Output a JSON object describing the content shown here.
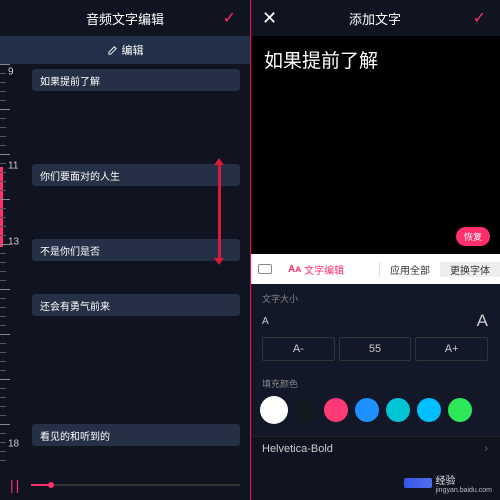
{
  "left": {
    "title": "音频文字编辑",
    "edit_label": "编辑",
    "ticks": [
      9,
      11,
      13,
      18
    ],
    "items": [
      {
        "t": 5,
        "text": "如果提前了解"
      },
      {
        "t": 100,
        "text": "你们要面对的人生"
      },
      {
        "t": 175,
        "text": "不是你们是否"
      },
      {
        "t": 230,
        "text": "还会有勇气前来"
      },
      {
        "t": 360,
        "text": "看见的和听到的"
      }
    ]
  },
  "right": {
    "title": "添加文字",
    "preview_text": "如果提前了解",
    "restore": "恢复",
    "tab_edit": "文字编辑",
    "tab_applyall": "应用全部",
    "tab_changefont": "更换字体",
    "size_label": "文字大小",
    "size_value": "55",
    "size_minus": "A-",
    "size_plus": "A+",
    "fill_label": "填充颜色",
    "colors": [
      {
        "hex": "#ffffff",
        "sel": true
      },
      {
        "hex": "#14181f"
      },
      {
        "hex": "#ff3b77"
      },
      {
        "hex": "#1e90ff"
      },
      {
        "hex": "#00c4d6"
      },
      {
        "hex": "#00bfff"
      },
      {
        "hex": "#2ee85b"
      }
    ],
    "font_name": "Helvetica-Bold"
  },
  "watermark": {
    "brand": "Baidu",
    "sub": "经验",
    "url": "jingyan.baidu.com"
  }
}
